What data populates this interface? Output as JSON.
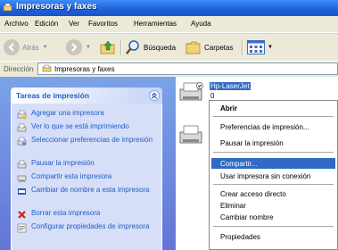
{
  "window": {
    "title": "Impresoras y faxes"
  },
  "menu": [
    "Archivo",
    "Edición",
    "Ver",
    "Favoritos",
    "Herramientas",
    "Ayuda"
  ],
  "toolbar": {
    "back": "Atrás",
    "search": "Búsqueda",
    "folders": "Carpetas"
  },
  "address": {
    "label": "Dirección",
    "value": "Impresoras y faxes"
  },
  "tasks": {
    "title": "Tareas de impresión",
    "items": [
      "Agregar una impresora",
      "Ver lo que se está imprimiendo",
      "Seleccionar preferencias de impresión",
      "Pausar la impresión",
      "Compartir esta impresora",
      "Cambiar de nombre a esta impresora",
      "Borrar esta impresora",
      "Configurar propiedades de impresora"
    ]
  },
  "printer": {
    "name": "Hp-LaserJet",
    "count": "0"
  },
  "context_menu": {
    "items": [
      "Abrir",
      "Preferencias de impresión...",
      "Pausar la impresión",
      "Compartir...",
      "Usar impresora sin conexión",
      "Crear acceso directo",
      "Eliminar",
      "Cambiar nombre",
      "Propiedades"
    ],
    "highlighted": "Compartir..."
  },
  "colors": {
    "titlebar": "#1f5fd8",
    "task_link": "#215dc6",
    "selection": "#316ac5",
    "pane": "#6f8ee0"
  }
}
